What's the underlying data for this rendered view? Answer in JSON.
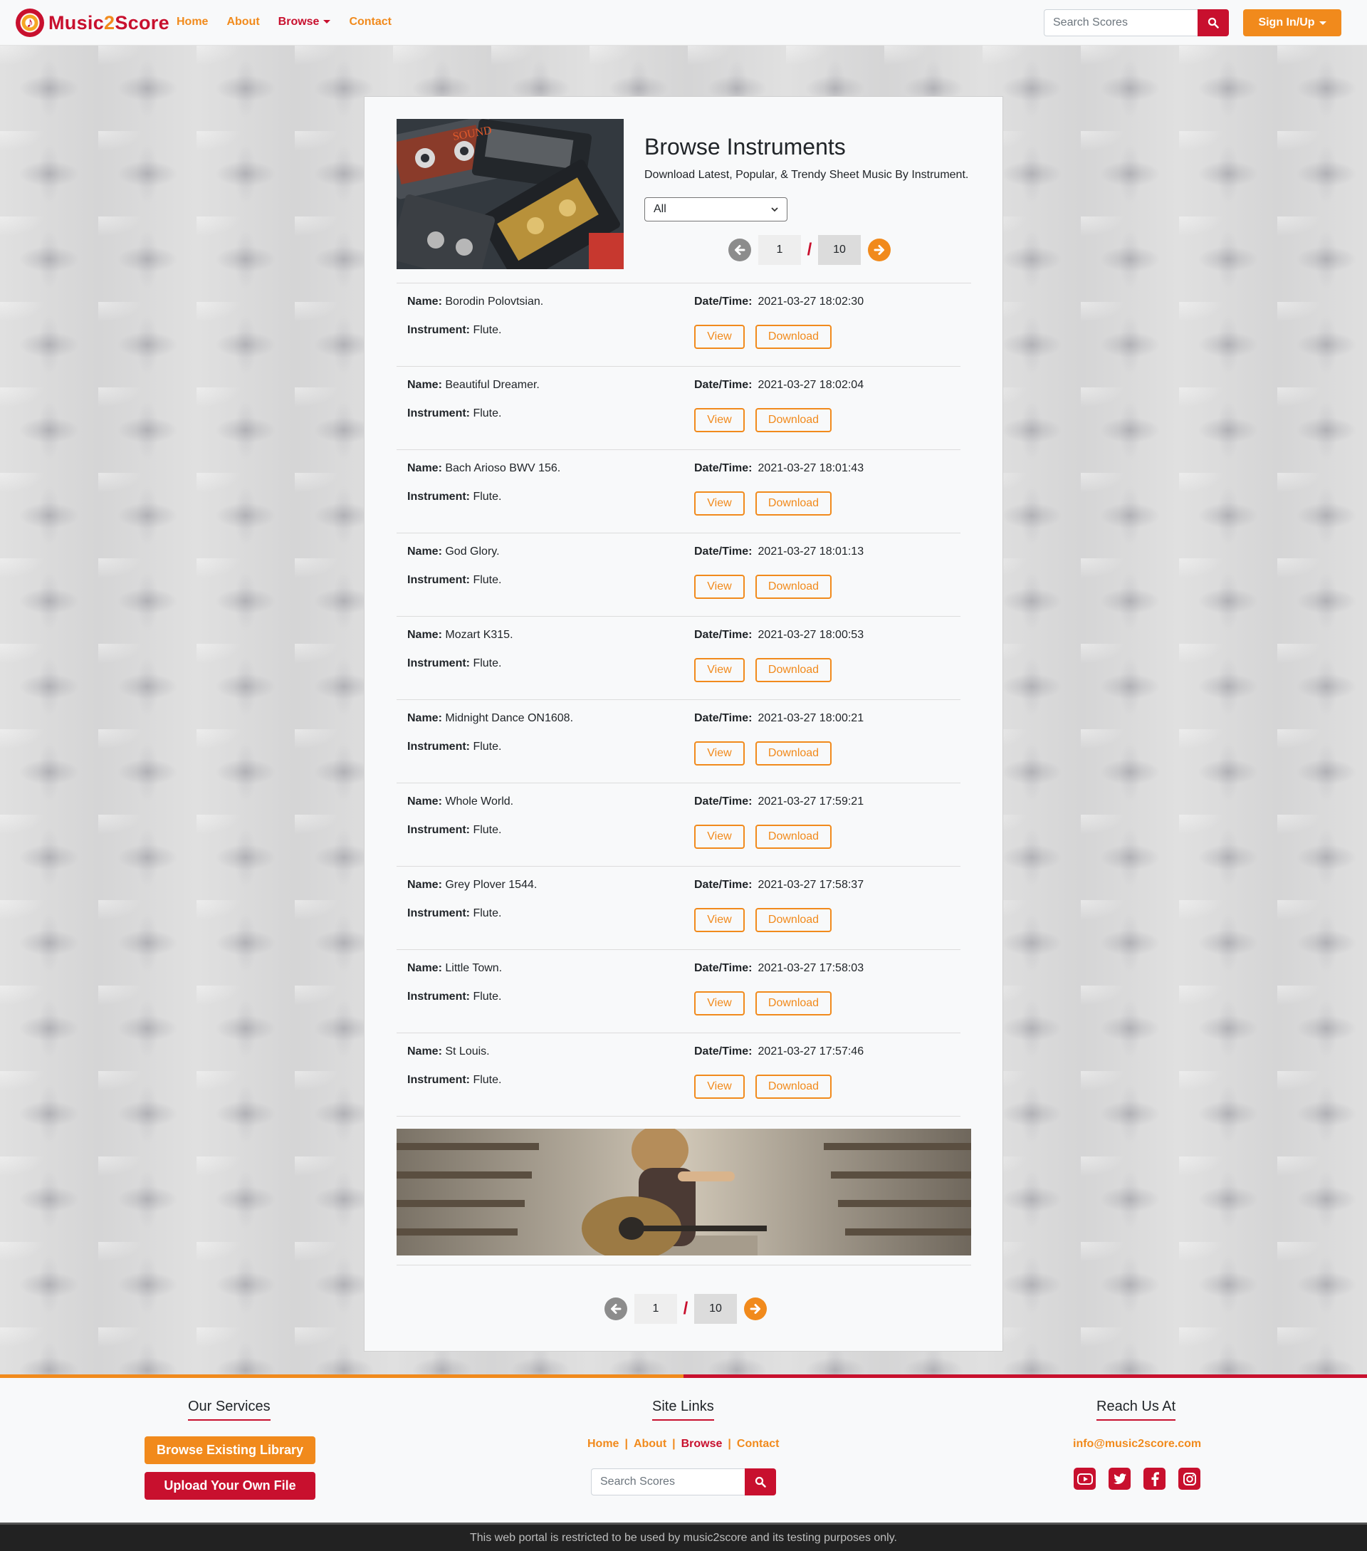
{
  "brand": {
    "name_part1": "Music",
    "name_part2": "2",
    "name_part3": "Score"
  },
  "nav": {
    "links": [
      {
        "label": "Home"
      },
      {
        "label": "About"
      },
      {
        "label": "Browse"
      },
      {
        "label": "Contact"
      }
    ],
    "search_placeholder": "Search Scores",
    "signin_label": "Sign In/Up"
  },
  "header": {
    "title": "Browse Instruments",
    "subtitle": "Download Latest, Popular, & Trendy Sheet Music By Instrument.",
    "filter_value": "All"
  },
  "pagination": {
    "current": "1",
    "separator": "/",
    "total": "10"
  },
  "labels": {
    "name": "Name:",
    "instrument": "Instrument:",
    "datetime": "Date/Time:",
    "view": "View",
    "download": "Download"
  },
  "scores": [
    {
      "name": "Borodin Polovtsian.",
      "instrument": "Flute.",
      "datetime": "2021-03-27 18:02:30"
    },
    {
      "name": "Beautiful Dreamer.",
      "instrument": "Flute.",
      "datetime": "2021-03-27 18:02:04"
    },
    {
      "name": "Bach Arioso BWV 156.",
      "instrument": "Flute.",
      "datetime": "2021-03-27 18:01:43"
    },
    {
      "name": "God Glory.",
      "instrument": "Flute.",
      "datetime": "2021-03-27 18:01:13"
    },
    {
      "name": "Mozart K315.",
      "instrument": "Flute.",
      "datetime": "2021-03-27 18:00:53"
    },
    {
      "name": "Midnight Dance ON1608.",
      "instrument": "Flute.",
      "datetime": "2021-03-27 18:00:21"
    },
    {
      "name": "Whole World.",
      "instrument": "Flute.",
      "datetime": "2021-03-27 17:59:21"
    },
    {
      "name": "Grey Plover 1544.",
      "instrument": "Flute.",
      "datetime": "2021-03-27 17:58:37"
    },
    {
      "name": "Little Town.",
      "instrument": "Flute.",
      "datetime": "2021-03-27 17:58:03"
    },
    {
      "name": "St Louis.",
      "instrument": "Flute.",
      "datetime": "2021-03-27 17:57:46"
    }
  ],
  "footer": {
    "services": {
      "title": "Our Services",
      "browse_label": "Browse Existing Library",
      "upload_label": "Upload Your Own File"
    },
    "site_links": {
      "title": "Site Links",
      "links": [
        {
          "label": "Home"
        },
        {
          "label": "About"
        },
        {
          "label": "Browse"
        },
        {
          "label": "Contact"
        }
      ],
      "separator": "|",
      "search_placeholder": "Search Scores"
    },
    "reach": {
      "title": "Reach Us At",
      "email": "info@music2score.com",
      "socials": [
        "youtube-icon",
        "twitter-icon",
        "facebook-icon",
        "instagram-icon"
      ]
    },
    "notice": "This web portal is restricted to be used by music2score and its testing purposes only."
  },
  "colors": {
    "orange": "#f18a1c",
    "crimson": "#c8102e",
    "grey_arrow": "#8c8c8c"
  }
}
